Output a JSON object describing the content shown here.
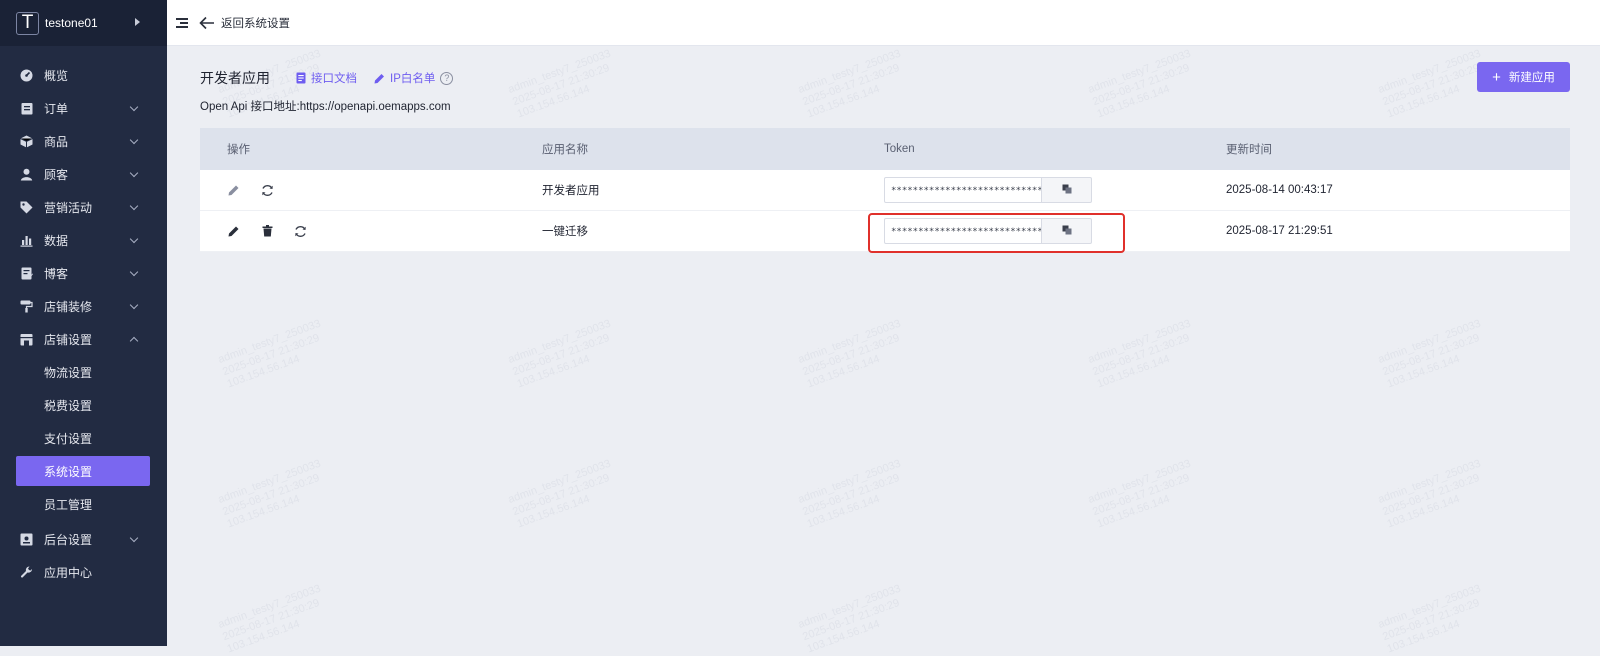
{
  "sidebar": {
    "logo_letter": "T",
    "store_name": "testone01",
    "menu": [
      {
        "label": "概览",
        "icon": "dashboard-icon"
      },
      {
        "label": "订单",
        "icon": "order-icon"
      },
      {
        "label": "商品",
        "icon": "product-icon"
      },
      {
        "label": "顾客",
        "icon": "customer-icon"
      },
      {
        "label": "营销活动",
        "icon": "tag-icon"
      },
      {
        "label": "数据",
        "icon": "chart-icon"
      },
      {
        "label": "博客",
        "icon": "blog-icon"
      },
      {
        "label": "店铺装修",
        "icon": "paint-roller-icon"
      },
      {
        "label": "店铺设置",
        "icon": "store-icon"
      },
      {
        "label": "后台设置",
        "icon": "admin-icon"
      },
      {
        "label": "应用中心",
        "icon": "wrench-icon"
      }
    ],
    "submenu": [
      {
        "label": "物流设置"
      },
      {
        "label": "税费设置"
      },
      {
        "label": "支付设置"
      },
      {
        "label": "系统设置"
      },
      {
        "label": "员工管理"
      }
    ]
  },
  "topbar": {
    "back_label": "返回系统设置"
  },
  "page": {
    "title": "开发者应用",
    "doc_link": "接口文档",
    "ip_link": "IP白名单",
    "api_url": "Open Api 接口地址:https://openapi.oemapps.com",
    "new_button": "新建应用"
  },
  "table": {
    "headers": [
      "操作",
      "应用名称",
      "Token",
      "更新时间"
    ],
    "rows": [
      {
        "name": "开发者应用",
        "token": "*****************************",
        "updated": "2025-08-14 00:43:17"
      },
      {
        "name": "一键迁移",
        "token": "*****************************",
        "updated": "2025-08-17 21:29:51"
      }
    ]
  },
  "watermark": "admin_testy7_250033\n2025-08-17 21:30:29\n103.154.56.144",
  "colors": {
    "accent": "#7a67f0",
    "sidebar_bg": "#222b42",
    "highlight": "#e0302b"
  }
}
